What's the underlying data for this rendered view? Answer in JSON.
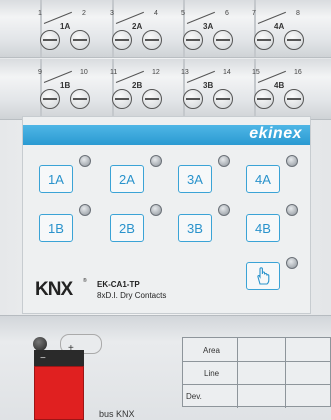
{
  "terminals_top": {
    "groups": [
      {
        "label": "1A",
        "num_left": "1",
        "num_right": "2"
      },
      {
        "label": "2A",
        "num_left": "3",
        "num_right": "4"
      },
      {
        "label": "3A",
        "num_left": "5",
        "num_right": "6"
      },
      {
        "label": "4A",
        "num_left": "7",
        "num_right": "8"
      }
    ]
  },
  "terminals_mid": {
    "groups": [
      {
        "label": "1B",
        "num_left": "9",
        "num_right": "10"
      },
      {
        "label": "2B",
        "num_left": "11",
        "num_right": "12"
      },
      {
        "label": "3B",
        "num_left": "13",
        "num_right": "14"
      },
      {
        "label": "4B",
        "num_left": "15",
        "num_right": "16"
      }
    ]
  },
  "panel": {
    "brand": "ekinex",
    "buttons_row1": [
      "1A",
      "2A",
      "3A",
      "4A"
    ],
    "buttons_row2": [
      "1B",
      "2B",
      "3B",
      "4B"
    ],
    "knx_logo": "KNX",
    "trademark": "®",
    "model": "EK-CA1-TP",
    "description": "8xD.I. Dry Contacts",
    "prog_icon": "hand-pointer-icon"
  },
  "bottom": {
    "minus": "−",
    "plus": "+",
    "bus_label": "bus KNX",
    "id_labels": [
      "Area",
      "Line",
      "Dev."
    ]
  },
  "colors": {
    "accent": "#2a9ad2",
    "connector": "#e02020"
  }
}
